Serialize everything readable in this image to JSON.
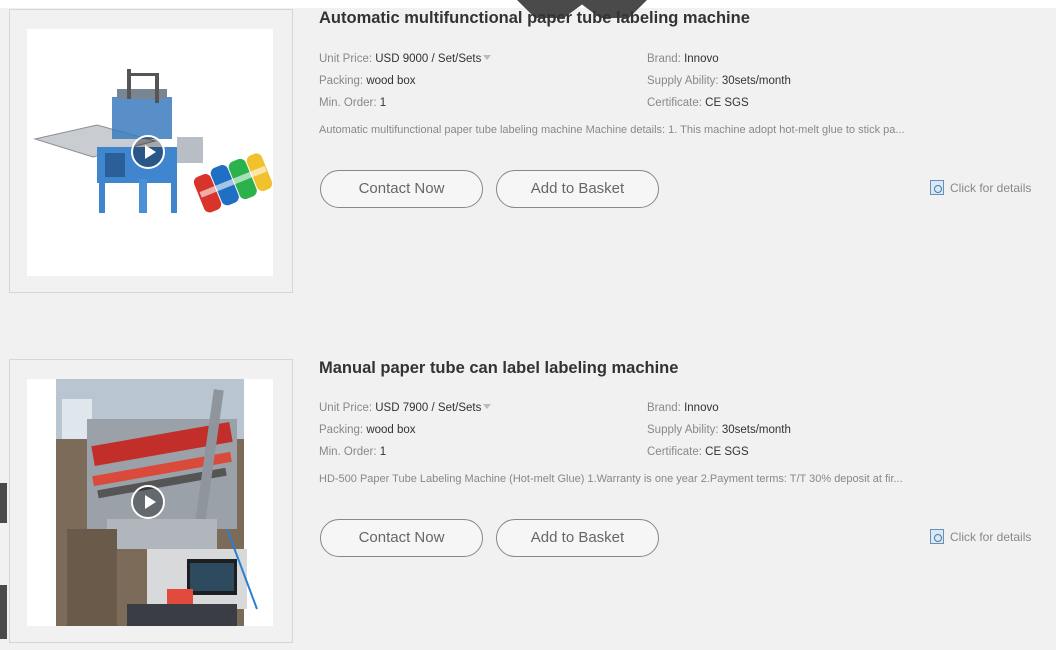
{
  "products": [
    {
      "title": "Automatic multifunctional paper tube labeling machine",
      "unit_price_label": "Unit Price:",
      "unit_price_value": "USD 9000 / Set/Sets",
      "packing_label": "Packing:",
      "packing_value": "wood box",
      "min_order_label": "Min. Order:",
      "min_order_value": "1",
      "brand_label": "Brand:",
      "brand_value": "Innovo",
      "supply_label": "Supply Ability:",
      "supply_value": "30sets/month",
      "certificate_label": "Certificate:",
      "certificate_value": "CE SGS",
      "description": "Automatic multifunctional paper tube labeling machine Machine details: 1. This machine adopt hot-melt glue to stick pa...",
      "contact_label": "Contact Now",
      "basket_label": "Add to Basket",
      "details_label": "Click for details"
    },
    {
      "title": "Manual paper tube can label labeling machine",
      "unit_price_label": "Unit Price:",
      "unit_price_value": "USD 7900 / Set/Sets",
      "packing_label": "Packing:",
      "packing_value": "wood box",
      "min_order_label": "Min. Order:",
      "min_order_value": "1",
      "brand_label": "Brand:",
      "brand_value": "Innovo",
      "supply_label": "Supply Ability:",
      "supply_value": "30sets/month",
      "certificate_label": "Certificate:",
      "certificate_value": "CE SGS",
      "description": "HD-500 Paper Tube Labeling Machine (Hot-melt Glue) 1.Warranty is one year 2.Payment terms: T/T 30% deposit at fir...",
      "contact_label": "Contact Now",
      "basket_label": "Add to Basket",
      "details_label": "Click for details"
    }
  ],
  "icons": {
    "play": "play-circle-icon",
    "dropdown": "caret-down-icon",
    "details": "document-magnifier-icon"
  }
}
